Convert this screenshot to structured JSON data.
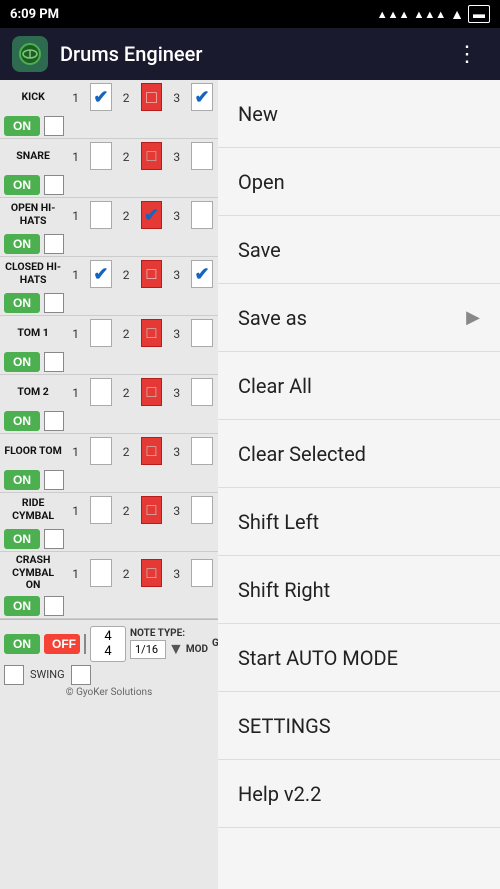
{
  "statusBar": {
    "time": "6:09 PM",
    "signal1": "▲▲▲",
    "signal2": "▲▲▲",
    "wifi": "WiFi",
    "battery": "Battery"
  },
  "header": {
    "title": "Drums Engineer",
    "menuIcon": "⋮"
  },
  "tracks": [
    {
      "name": "KICK",
      "on": true,
      "beat1": "1",
      "beat2": "2",
      "beat3": "3",
      "cells": [
        "check",
        "red",
        "partial"
      ]
    },
    {
      "name": "SNARE",
      "on": true,
      "beat1": "1",
      "beat2": "2",
      "beat3": "3",
      "cells": [
        "empty",
        "red",
        "empty"
      ]
    },
    {
      "name": "OPEN HI-HATS",
      "on": true,
      "beat1": "1",
      "beat2": "2",
      "beat3": "3",
      "cells": [
        "empty",
        "red-check",
        "empty"
      ]
    },
    {
      "name": "CLOSED HI-HATS",
      "on": true,
      "beat1": "1",
      "beat2": "2",
      "beat3": "3",
      "cells": [
        "check",
        "red",
        "partial"
      ]
    },
    {
      "name": "TOM 1",
      "on": true,
      "beat1": "1",
      "beat2": "2",
      "beat3": "3",
      "cells": [
        "empty",
        "red",
        "empty"
      ]
    },
    {
      "name": "TOM 2",
      "on": true,
      "beat1": "1",
      "beat2": "2",
      "beat3": "3",
      "cells": [
        "empty",
        "red",
        "empty"
      ]
    },
    {
      "name": "FLOOR TOM",
      "on": true,
      "beat1": "1",
      "beat2": "2",
      "beat3": "3",
      "cells": [
        "empty",
        "red",
        "empty"
      ]
    },
    {
      "name": "RIDE CYMBAL",
      "on": true,
      "beat1": "1",
      "beat2": "2",
      "beat3": "3",
      "cells": [
        "empty",
        "red",
        "empty"
      ]
    },
    {
      "name": "CRASH CYMBAL ON",
      "on": true,
      "beat1": "1",
      "beat2": "2",
      "beat3": "3",
      "cells": [
        "empty",
        "red",
        "empty"
      ]
    }
  ],
  "menu": {
    "items": [
      {
        "label": "New",
        "hasArrow": false
      },
      {
        "label": "Open",
        "hasArrow": false
      },
      {
        "label": "Save",
        "hasArrow": false
      },
      {
        "label": "Save as",
        "hasArrow": true
      },
      {
        "label": "Clear All",
        "hasArrow": false
      },
      {
        "label": "Clear Selected",
        "hasArrow": false
      },
      {
        "label": "Shift Left",
        "hasArrow": false
      },
      {
        "label": "Shift Right",
        "hasArrow": false
      },
      {
        "label": "Start AUTO MODE",
        "hasArrow": false
      },
      {
        "label": "SETTINGS",
        "hasArrow": false
      },
      {
        "label": "Help v2.2",
        "hasArrow": false
      }
    ]
  },
  "bottomBar": {
    "onLabel": "ON",
    "offLabel": "OFF",
    "timeSig": "4/4",
    "noteLabel": "NOTE TYPE:",
    "noteValue": "1/16",
    "modeLabel": "MOD",
    "grooveLabel": "GROO",
    "swingLabel": "SWING"
  },
  "copyright": "© GyoKer Solutions"
}
